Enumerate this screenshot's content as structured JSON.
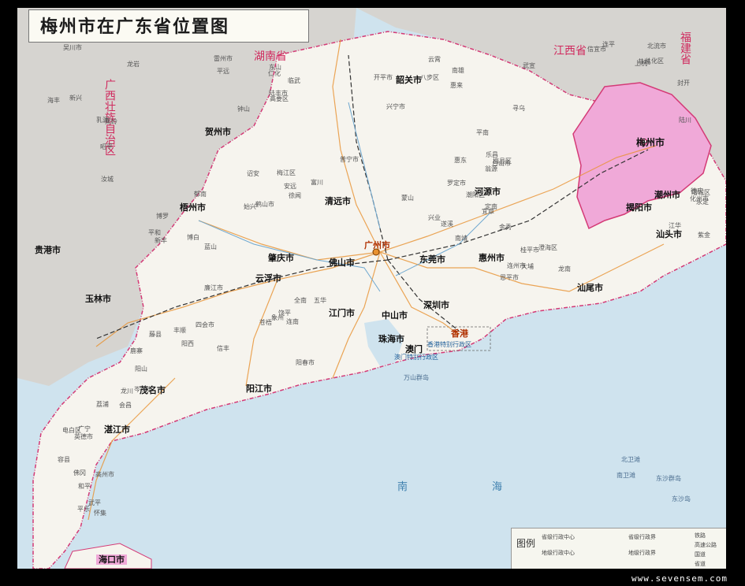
{
  "title": "梅州市在广东省位置图",
  "watermark": "www.sevensem.com",
  "colors": {
    "land": "#f6f4ee",
    "neighbor_province": "#d6d4d0",
    "sea": "#cfe3ee",
    "highlight": "#f0a9d8",
    "boundary": "#d43a76",
    "road": "#e8912f",
    "rail": "#333333"
  },
  "provinces": [
    "湖南省",
    "江西省",
    "福建省",
    "广西壮族自治区"
  ],
  "cities": [
    "梅州市",
    "广州市",
    "深圳市",
    "珠海市",
    "汕头市",
    "韶关市",
    "河源市",
    "惠州市",
    "汕尾市",
    "揭阳市",
    "潮州市",
    "东莞市",
    "中山市",
    "江门市",
    "佛山市",
    "肇庆市",
    "清远市",
    "云浮市",
    "阳江市",
    "茂名市",
    "湛江市",
    "澳门",
    "香港",
    "梧州市",
    "贵港市",
    "玉林市",
    "贺州市",
    "海口市"
  ],
  "counties": [
    "蕉岭",
    "平远",
    "梅江区",
    "兴宁市",
    "梅县区",
    "大埔",
    "五华",
    "丰顺",
    "龙川",
    "和平",
    "连平",
    "紫金",
    "新丰",
    "翁源",
    "乳源",
    "仁化",
    "始兴",
    "南雄",
    "乐昌",
    "连州市",
    "连南",
    "阳山",
    "英德市",
    "佛冈",
    "从化区",
    "增城区",
    "博罗",
    "惠东",
    "海丰",
    "陆丰市",
    "普宁市",
    "惠来",
    "潮阳区",
    "澄海区",
    "饶平",
    "四会市",
    "广宁",
    "怀集",
    "封开",
    "德庆",
    "郁南",
    "罗定市",
    "新兴",
    "高要区",
    "鹤山市",
    "开平市",
    "台山市",
    "恩平市",
    "阳春市",
    "阳西",
    "电白区",
    "高州市",
    "信宜市",
    "化州市",
    "廉江市",
    "遂溪",
    "吴川市",
    "雷州市",
    "徐闻",
    "武宣",
    "平南",
    "桂平市",
    "苍梧",
    "藤县",
    "岑溪市",
    "容县",
    "北流市",
    "陆川",
    "博白",
    "兴业",
    "昭平",
    "钟山",
    "富川",
    "八步区",
    "蒙山",
    "金秀",
    "象州",
    "鹿寨",
    "荔浦",
    "平乐",
    "恭城",
    "江华",
    "蓝山",
    "宜章",
    "汝城",
    "临武",
    "安远",
    "寻乌",
    "定南",
    "龙南",
    "全南",
    "信丰",
    "会昌",
    "武平",
    "上杭",
    "永定",
    "平和",
    "南靖",
    "龙岩",
    "东山",
    "诏安",
    "云霄"
  ],
  "seas": [
    "南",
    "海"
  ],
  "islands": [
    "万山群岛",
    "东沙群岛",
    "北卫滩",
    "南卫滩",
    "东沙岛"
  ],
  "annotations": [
    "香港特别行政区",
    "澳门特别行政区"
  ],
  "legend": {
    "title": "图例",
    "items": [
      "省级行政中心",
      "地级行政中心",
      "省级行政界",
      "地级行政界",
      "铁路",
      "高速公路",
      "国道",
      "省道"
    ]
  }
}
